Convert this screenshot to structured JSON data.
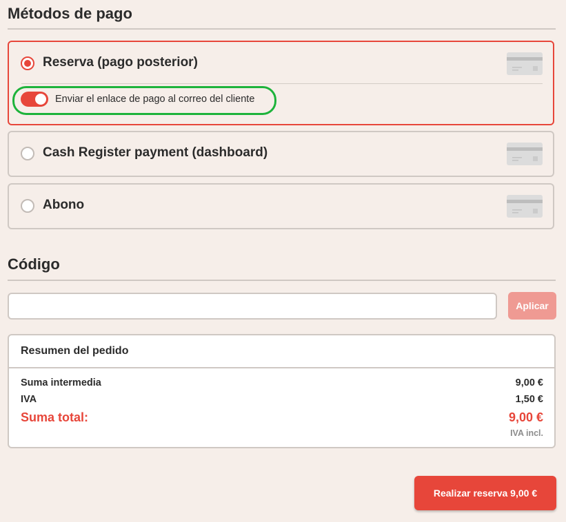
{
  "payment_methods": {
    "title": "Métodos de pago",
    "options": [
      {
        "label": "Reserva (pago posterior)",
        "selected": true,
        "icon": "credit-card-icon",
        "toggle": {
          "label": "Enviar el enlace de pago al correo del cliente",
          "on": true
        }
      },
      {
        "label": "Cash Register payment (dashboard)",
        "selected": false,
        "icon": "credit-card-icon"
      },
      {
        "label": "Abono",
        "selected": false,
        "icon": "credit-card-icon"
      }
    ]
  },
  "code": {
    "title": "Código",
    "input_value": "",
    "apply_label": "Aplicar"
  },
  "summary": {
    "title": "Resumen del pedido",
    "rows": [
      {
        "label": "Suma intermedia",
        "value": "9,00 €"
      },
      {
        "label": "IVA",
        "value": "1,50 €"
      }
    ],
    "total": {
      "label": "Suma total:",
      "value": "9,00 €"
    },
    "vat_note": "IVA incl."
  },
  "actions": {
    "book_label": "Realizar reserva 9,00 €"
  },
  "colors": {
    "accent": "#e7463a",
    "accent_disabled": "#ef9a93",
    "background": "#f6eee9",
    "border": "#cfc8c3",
    "highlight": "#1db33b"
  }
}
